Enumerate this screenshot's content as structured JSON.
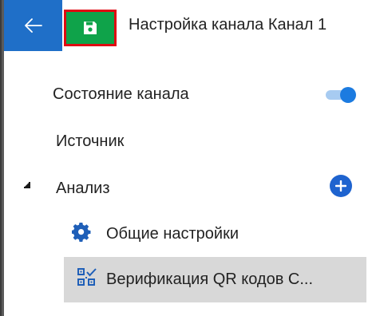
{
  "header": {
    "title": "Настройка канала Канал 1",
    "back_icon": "arrow-left-icon",
    "save_icon": "floppy-disk-icon"
  },
  "colors": {
    "accent": "#1f6fc8",
    "save_bg": "#0fa34a",
    "save_border": "#e00a12",
    "selected_bg": "#d8d8d8"
  },
  "settings": {
    "channel_state_label": "Состояние канала",
    "channel_state_on": true,
    "source_label": "Источник",
    "analysis_label": "Анализ",
    "analysis_children": [
      {
        "label": "Общие настройки",
        "icon": "gear-icon"
      },
      {
        "label": "Верификация QR кодов С...",
        "icon": "qr-code-check-icon",
        "selected": true
      }
    ]
  }
}
